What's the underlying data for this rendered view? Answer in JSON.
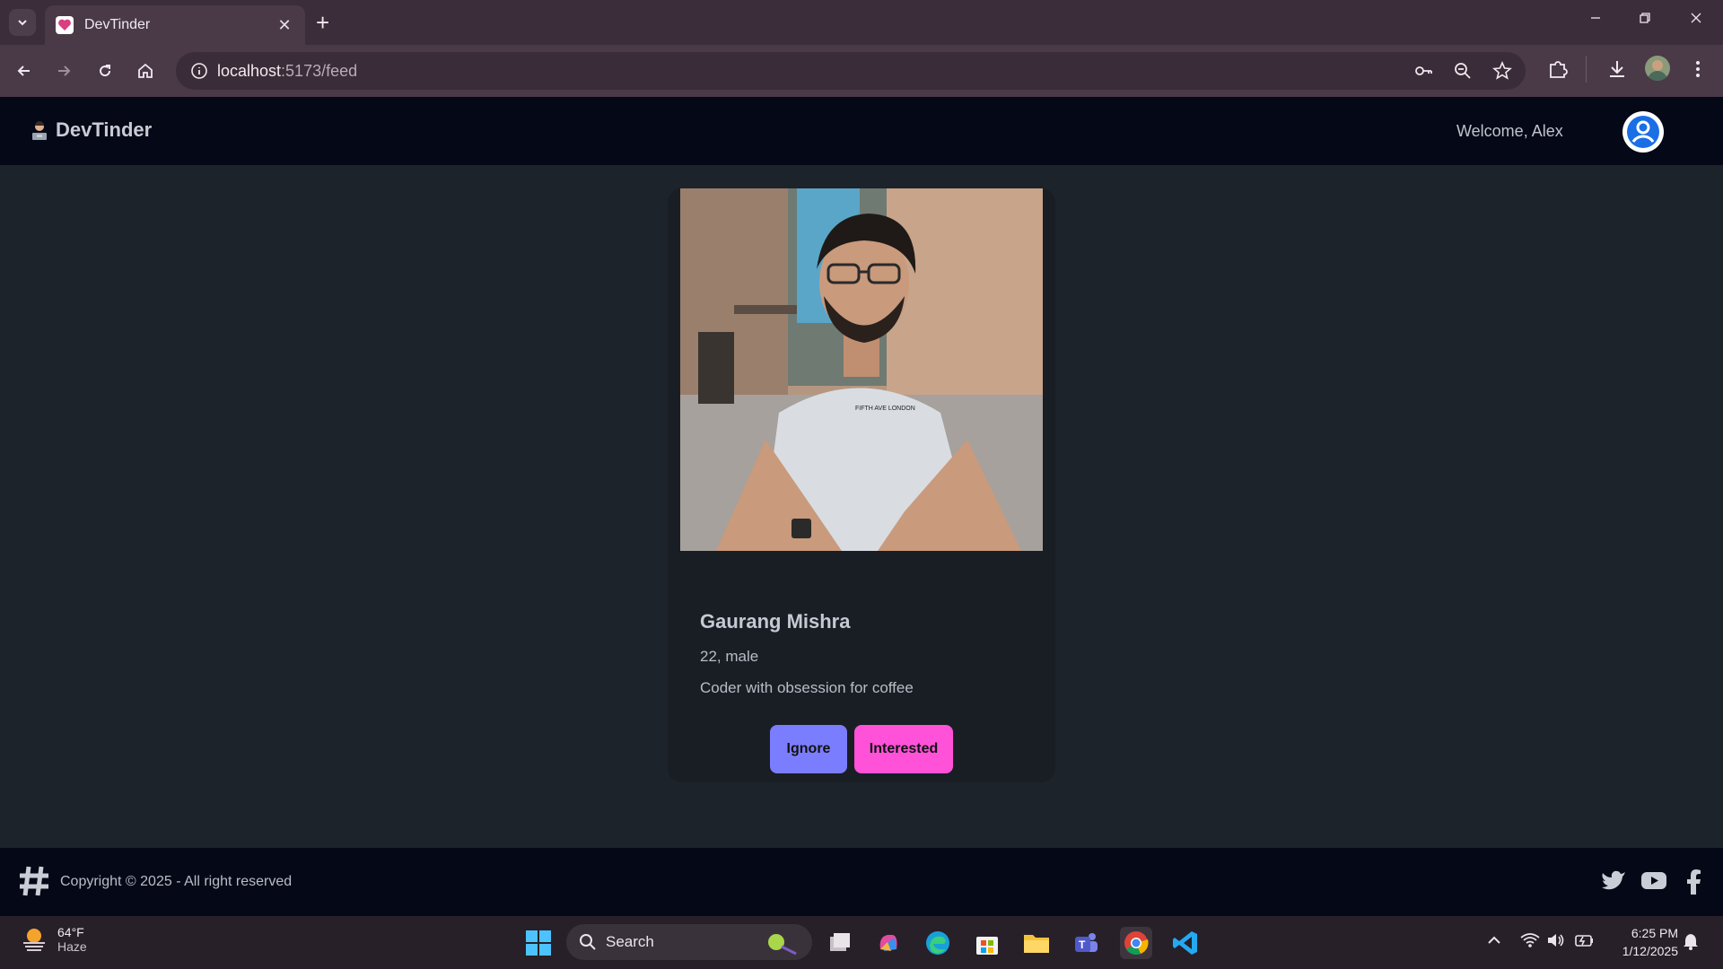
{
  "browser": {
    "tab_title": "DevTinder",
    "url_host": "localhost",
    "url_path": ":5173/feed"
  },
  "app": {
    "brand": "DevTinder",
    "welcome": "Welcome, Alex"
  },
  "profile": {
    "name": "Gaurang Mishra",
    "meta": "22, male",
    "about": "Coder with obsession for coffee",
    "ignore_label": "Ignore",
    "interested_label": "Interested"
  },
  "footer": {
    "copyright": "Copyright © 2025 - All right reserved"
  },
  "taskbar": {
    "temperature": "64°F",
    "condition": "Haze",
    "search_label": "Search",
    "time": "6:25 PM",
    "date": "1/12/2025"
  },
  "colors": {
    "ignore": "#7b7dff",
    "interested": "#ff52d9",
    "navbar": "#050816",
    "page_bg": "#1d232a"
  }
}
